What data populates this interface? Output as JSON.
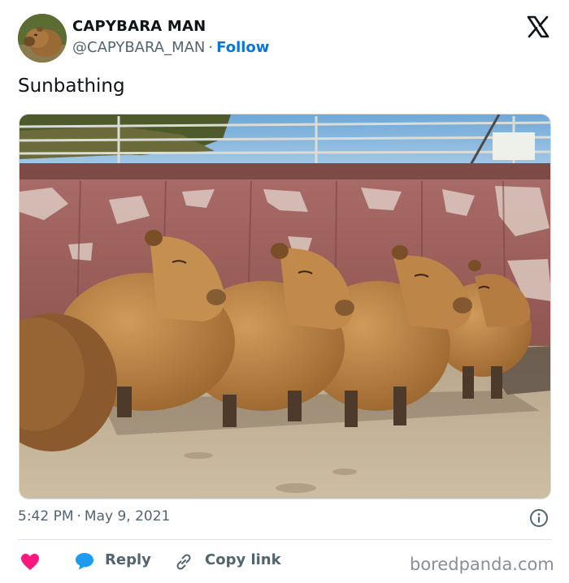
{
  "author": {
    "name": "CAPYBARA MAN",
    "handle": "@CAPYBARA_MAN",
    "separator": "·",
    "follow_label": "Follow"
  },
  "tweet": {
    "text": "Sunbathing",
    "time": "5:42 PM",
    "separator": "·",
    "date": "May 9, 2021"
  },
  "actions": {
    "like_icon": "heart-icon",
    "reply_label": "Reply",
    "reply_icon": "speech-bubble-icon",
    "copy_link_label": "Copy link",
    "copy_link_icon": "link-icon",
    "info_icon": "info-icon"
  },
  "watermark": "boredpanda.com",
  "colors": {
    "follow_blue": "#0a76d6",
    "heart_pink": "#f91880",
    "reply_blue": "#1d9bf0",
    "secondary_text": "#536471"
  }
}
